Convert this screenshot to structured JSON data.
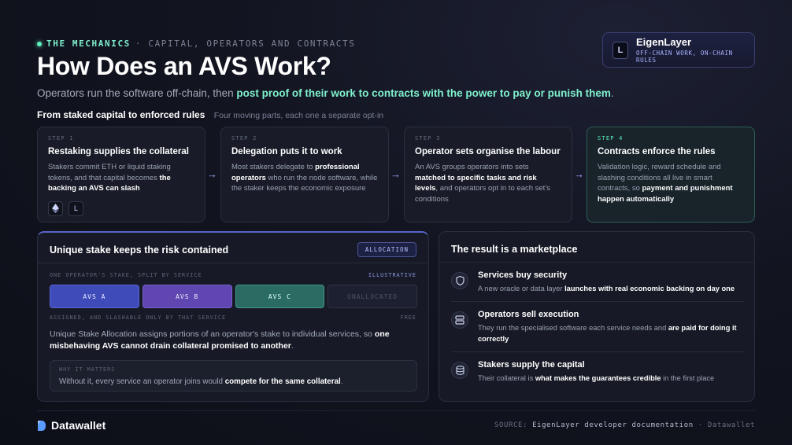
{
  "header": {
    "eyebrow_primary": "THE MECHANICS",
    "eyebrow_secondary": "· CAPITAL, OPERATORS AND CONTRACTS",
    "title": "How Does an AVS Work?",
    "subtitle_lead": "Operators run the software off-chain, then ",
    "subtitle_highlight": "post proof of their work to contracts with the power to pay or punish them",
    "subtitle_end": ".",
    "accent_color": "#7ff0cc"
  },
  "brand": {
    "logo_letter": "L",
    "name": "EigenLayer",
    "tagline": "OFF-CHAIN WORK, ON-CHAIN RULES"
  },
  "section": {
    "label": "From staked capital to enforced rules",
    "note": "Four moving parts, each one a separate opt-in"
  },
  "steps": [
    {
      "num": "STEP 1",
      "title": "Restaking supplies the collateral",
      "b1": "Stakers commit ETH or liquid staking tokens, and that capital becomes ",
      "b2": "the backing an AVS can slash",
      "b3": "",
      "b4": "",
      "b5": "",
      "icons": [
        "ethereum-icon",
        "eigenlayer-icon"
      ]
    },
    {
      "num": "STEP 2",
      "title": "Delegation puts it to work",
      "b1": "Most stakers delegate to ",
      "b2": "professional operators",
      "b3": " who run the node software, while the staker keeps the economic exposure",
      "b4": "",
      "b5": ""
    },
    {
      "num": "STEP 3",
      "title": "Operator sets organise the labour",
      "b1": "An AVS groups operators into sets ",
      "b2": "matched to specific tasks and risk levels",
      "b3": ", and operators opt in to each set's conditions",
      "b4": "",
      "b5": ""
    },
    {
      "num": "STEP 4",
      "title": "Contracts enforce the rules",
      "b1": "Validation logic, reward schedule and slashing conditions all live in smart contracts, so ",
      "b2": "payment and punishment happen automatically",
      "b3": "",
      "b4": "",
      "b5": ""
    }
  ],
  "allocation": {
    "title": "Unique stake keeps the risk contained",
    "pill": "ALLOCATION",
    "caption_left": "ONE OPERATOR'S STAKE, SPLIT BY SERVICE",
    "caption_right": "ILLUSTRATIVE",
    "bars": [
      "AVS A",
      "AVS B",
      "AVS C",
      "UNALLOCATED"
    ],
    "footer_left": "ASSIGNED, AND SLASHABLE ONLY BY THAT SERVICE",
    "footer_right": "FREE",
    "para_1": "Unique Stake Allocation assigns portions of an operator's stake to individual services, so ",
    "para_2": "one misbehaving AVS cannot drain collateral promised to another",
    "para_3": ".",
    "why_label": "WHY IT MATTERS",
    "why_1": "Without it, every service an operator joins would ",
    "why_2": "compete for the same collateral",
    "why_3": "."
  },
  "result": {
    "title": "The result is a marketplace",
    "items": [
      {
        "icon": "shield-icon",
        "title": "Services buy security",
        "b1": "A new oracle or data layer ",
        "b2": "launches with real economic backing on day one",
        "b3": ""
      },
      {
        "icon": "server-icon",
        "title": "Operators sell execution",
        "b1": "They run the specialised software each service needs and ",
        "b2": "are paid for doing it correctly",
        "b3": ""
      },
      {
        "icon": "database-icon",
        "title": "Stakers supply the capital",
        "b1": "Their collateral is ",
        "b2": "what makes the guarantees credible",
        "b3": " in the first place"
      }
    ]
  },
  "footer": {
    "brand": "Datawallet",
    "source_label": "SOURCE:",
    "source_text": "EigenLayer developer documentation",
    "source_sep": " · ",
    "source_brand": "Datawallet"
  }
}
